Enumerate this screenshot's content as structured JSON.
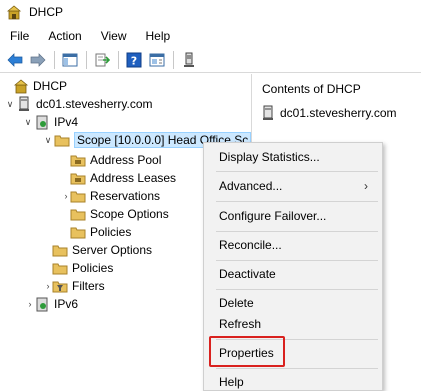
{
  "window": {
    "title": "DHCP",
    "icon": "dhcp-server-icon"
  },
  "menu": [
    "File",
    "Action",
    "View",
    "Help"
  ],
  "toolbar": {
    "buttons": [
      "back-arrow-icon",
      "forward-arrow-icon",
      "show-hide-tree-icon",
      "export-list-icon",
      "help-icon",
      "properties-icon",
      "server-icon"
    ]
  },
  "tree": {
    "root": "DHCP",
    "server": "dc01.stevesherry.com",
    "ipv4": "IPv4",
    "scope": "Scope [10.0.0.0] Head Office Sc",
    "scope_children": [
      "Address Pool",
      "Address Leases",
      "Reservations",
      "Scope Options",
      "Policies"
    ],
    "server_options": "Server Options",
    "policies": "Policies",
    "filters": "Filters",
    "ipv6": "IPv6"
  },
  "content_pane": {
    "title": "Contents of DHCP",
    "items": [
      "dc01.stevesherry.com"
    ]
  },
  "context_menu": {
    "items": [
      "Display Statistics...",
      "Advanced...",
      "Configure Failover...",
      "Reconcile...",
      "Deactivate",
      "Delete",
      "Refresh",
      "Properties",
      "Help"
    ],
    "submenu_arrow": "›",
    "highlighted": "Properties",
    "highlight_color": "#d9211e"
  },
  "colors": {
    "selection": "#cce8ff",
    "folder": "#e8c15e",
    "help_blue": "#1f5fbf"
  }
}
